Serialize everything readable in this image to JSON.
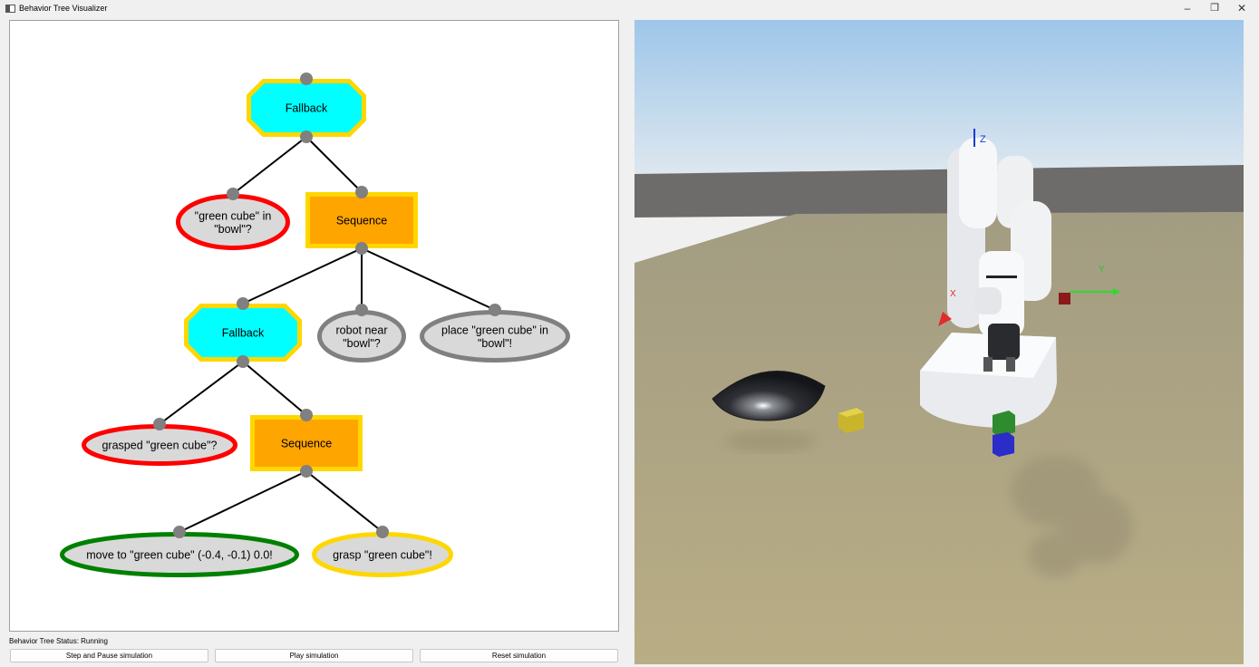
{
  "window": {
    "title": "Behavior Tree Visualizer",
    "controls": {
      "minimize": "–",
      "restore": "❐",
      "close": "✕"
    }
  },
  "tree": {
    "nodes": [
      {
        "id": "fallback-root",
        "shape": "octagon",
        "label": [
          "Fallback"
        ],
        "fill": "#00ffff",
        "border": "#ffd700"
      },
      {
        "id": "cond-green-cube-in-bowl",
        "shape": "ellipse",
        "label": [
          "\"green cube\" in",
          "\"bowl\"?"
        ],
        "fill": "#d9d9d9",
        "border": "#ff0000"
      },
      {
        "id": "sequence-main",
        "shape": "rect",
        "label": [
          "Sequence"
        ],
        "fill": "#ffa500",
        "border": "#ffd700"
      },
      {
        "id": "fallback-grasp",
        "shape": "octagon",
        "label": [
          "Fallback"
        ],
        "fill": "#00ffff",
        "border": "#ffd700"
      },
      {
        "id": "cond-robot-near-bowl",
        "shape": "ellipse",
        "label": [
          "robot near",
          "\"bowl\"?"
        ],
        "fill": "#d9d9d9",
        "border": "#808080"
      },
      {
        "id": "action-place-green-cube",
        "shape": "ellipse",
        "label": [
          "place \"green cube\" in",
          "\"bowl\"!"
        ],
        "fill": "#d9d9d9",
        "border": "#808080"
      },
      {
        "id": "cond-grasped-green-cube",
        "shape": "ellipse",
        "label": [
          "grasped \"green cube\"?"
        ],
        "fill": "#d9d9d9",
        "border": "#ff0000"
      },
      {
        "id": "sequence-sub",
        "shape": "rect",
        "label": [
          "Sequence"
        ],
        "fill": "#ffa500",
        "border": "#ffd700"
      },
      {
        "id": "action-move-to-green-cube",
        "shape": "ellipse",
        "label": [
          "move to \"green cube\" (-0.4, -0.1) 0.0!"
        ],
        "fill": "#d9d9d9",
        "border": "#008000"
      },
      {
        "id": "action-grasp-green-cube",
        "shape": "ellipse",
        "label": [
          "grasp \"green cube\"!"
        ],
        "fill": "#d9d9d9",
        "border": "#ffd700"
      }
    ],
    "edges": [
      [
        "fallback-root",
        "cond-green-cube-in-bowl"
      ],
      [
        "fallback-root",
        "sequence-main"
      ],
      [
        "sequence-main",
        "fallback-grasp"
      ],
      [
        "sequence-main",
        "cond-robot-near-bowl"
      ],
      [
        "sequence-main",
        "action-place-green-cube"
      ],
      [
        "fallback-grasp",
        "cond-grasped-green-cube"
      ],
      [
        "fallback-grasp",
        "sequence-sub"
      ],
      [
        "sequence-sub",
        "action-move-to-green-cube"
      ],
      [
        "sequence-sub",
        "action-grasp-green-cube"
      ]
    ]
  },
  "status": {
    "text": "Behavior Tree Status: Running"
  },
  "controls": {
    "step_label": "Step and Pause simulation",
    "play_label": "Play simulation",
    "reset_label": "Reset simulation"
  },
  "scene": {
    "axis_labels": {
      "z": "Z",
      "x": "X",
      "y": "Y"
    },
    "colors": {
      "sky_top": "#9ec6ea",
      "sky_bottom": "#dfe8ef",
      "floor": "#b1a883",
      "robot": "#f2f3f5",
      "bowl": "#2b2d31"
    }
  }
}
